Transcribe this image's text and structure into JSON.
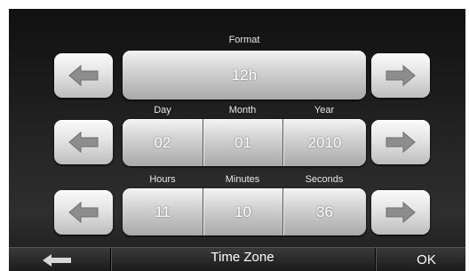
{
  "format": {
    "label": "Format",
    "value": "12h"
  },
  "date": {
    "headers": {
      "day": "Day",
      "month": "Month",
      "year": "Year"
    },
    "values": {
      "day": "02",
      "month": "01",
      "year": "2010"
    }
  },
  "time": {
    "headers": {
      "hours": "Hours",
      "minutes": "Minutes",
      "seconds": "Seconds"
    },
    "values": {
      "hours": "11",
      "minutes": "10",
      "seconds": "36"
    }
  },
  "bottom": {
    "timezone_label": "Time Zone",
    "ok_label": "OK",
    "back_icon": "back-arrow-icon"
  },
  "colors": {
    "button_gray": "#c8c8c8",
    "arrow_gray": "#8a8a8a",
    "background": "#1c1c1c"
  }
}
